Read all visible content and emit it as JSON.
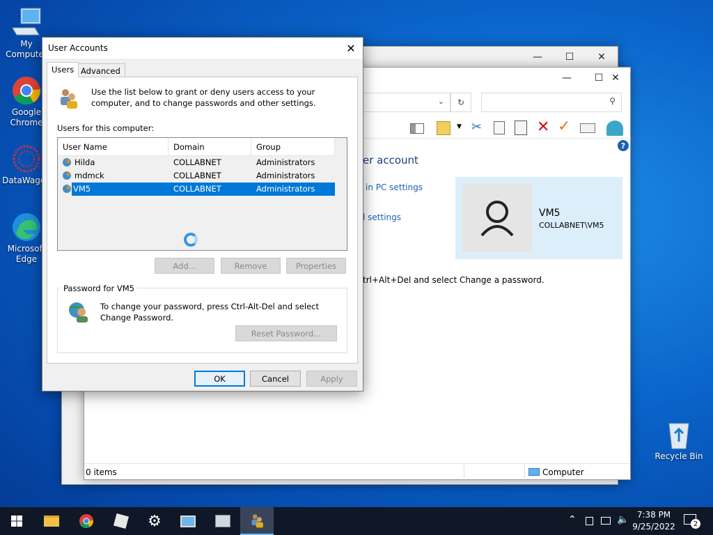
{
  "desktop": {
    "icons": [
      {
        "label": "My Computer",
        "icon": "computer-icon"
      },
      {
        "label": "Google Chrome",
        "icon": "chrome-icon"
      },
      {
        "label": "DataWagon",
        "icon": "datawagon-icon"
      },
      {
        "label": "Microsoft Edge",
        "icon": "edge-icon"
      },
      {
        "label": "Recycle Bin",
        "icon": "recycle-bin-icon"
      }
    ]
  },
  "explorer": {
    "heading": "er account",
    "link_pc_settings": "in PC settings",
    "link_settings": "l settings",
    "password_hint": "trl+Alt+Del and select Change a password.",
    "user_card": {
      "name": "VM5",
      "account": "COLLABNET\\VM5"
    },
    "status_items": "0 items",
    "status_computer": "Computer"
  },
  "dialog": {
    "title": "User Accounts",
    "tabs": [
      "Users",
      "Advanced"
    ],
    "intro_text": "Use the list below to grant or deny users access to your computer, and to change passwords and other settings.",
    "users_label": "Users for this computer:",
    "columns": [
      "User Name",
      "Domain",
      "Group"
    ],
    "rows": [
      {
        "name": "Hilda",
        "domain": "COLLABNET",
        "group": "Administrators"
      },
      {
        "name": "mdmck",
        "domain": "COLLABNET",
        "group": "Administrators"
      },
      {
        "name": "VM5",
        "domain": "COLLABNET",
        "group": "Administrators"
      }
    ],
    "buttons": {
      "add": "Add...",
      "remove": "Remove",
      "properties": "Properties"
    },
    "password_group": "Password for VM5",
    "password_text": "To change your password, press Ctrl-Alt-Del and select Change Password.",
    "reset_password": "Reset Password...",
    "ok": "OK",
    "cancel": "Cancel",
    "apply": "Apply"
  },
  "taskbar": {
    "time": "7:38 PM",
    "date": "9/25/2022",
    "notifications": "2"
  },
  "colors": {
    "accent": "#0078d7",
    "link": "#1b62b6",
    "taskbar": "#101828"
  }
}
